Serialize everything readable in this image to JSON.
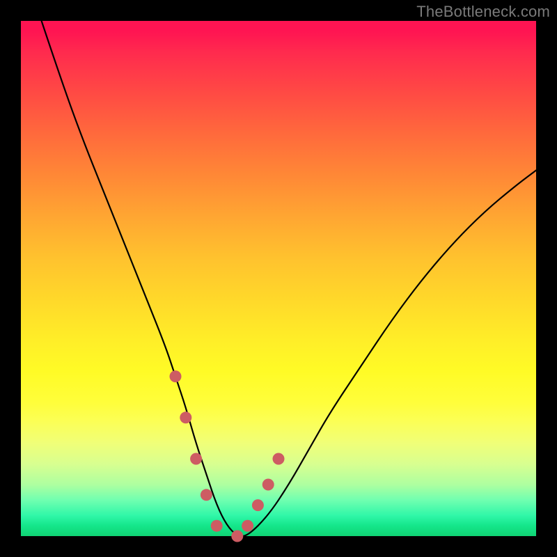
{
  "watermark": "TheBottleneck.com",
  "colors": {
    "background": "#000000",
    "curve_stroke": "#000000",
    "marker_fill": "#cd5c63",
    "gradient_top": "#ff1452",
    "gradient_bottom": "#10d474"
  },
  "chart_data": {
    "type": "line",
    "title": "",
    "xlabel": "",
    "ylabel": "",
    "xlim": [
      0,
      100
    ],
    "ylim": [
      0,
      100
    ],
    "series": [
      {
        "name": "bottleneck-curve",
        "x": [
          4,
          8,
          12,
          16,
          20,
          24,
          28,
          30,
          32,
          34,
          36,
          38,
          40,
          42,
          44,
          48,
          52,
          56,
          60,
          66,
          72,
          78,
          84,
          90,
          96,
          100
        ],
        "y": [
          100,
          88,
          77,
          67,
          57,
          47,
          37,
          31,
          25,
          18,
          12,
          6,
          2,
          0,
          0,
          4,
          10,
          17,
          24,
          33,
          42,
          50,
          57,
          63,
          68,
          71
        ]
      }
    ],
    "markers": {
      "name": "highlight-points",
      "x": [
        30,
        32,
        34,
        36,
        38,
        42,
        44,
        46,
        48,
        50
      ],
      "y": [
        31,
        23,
        15,
        8,
        2,
        0,
        2,
        6,
        10,
        15
      ]
    }
  }
}
